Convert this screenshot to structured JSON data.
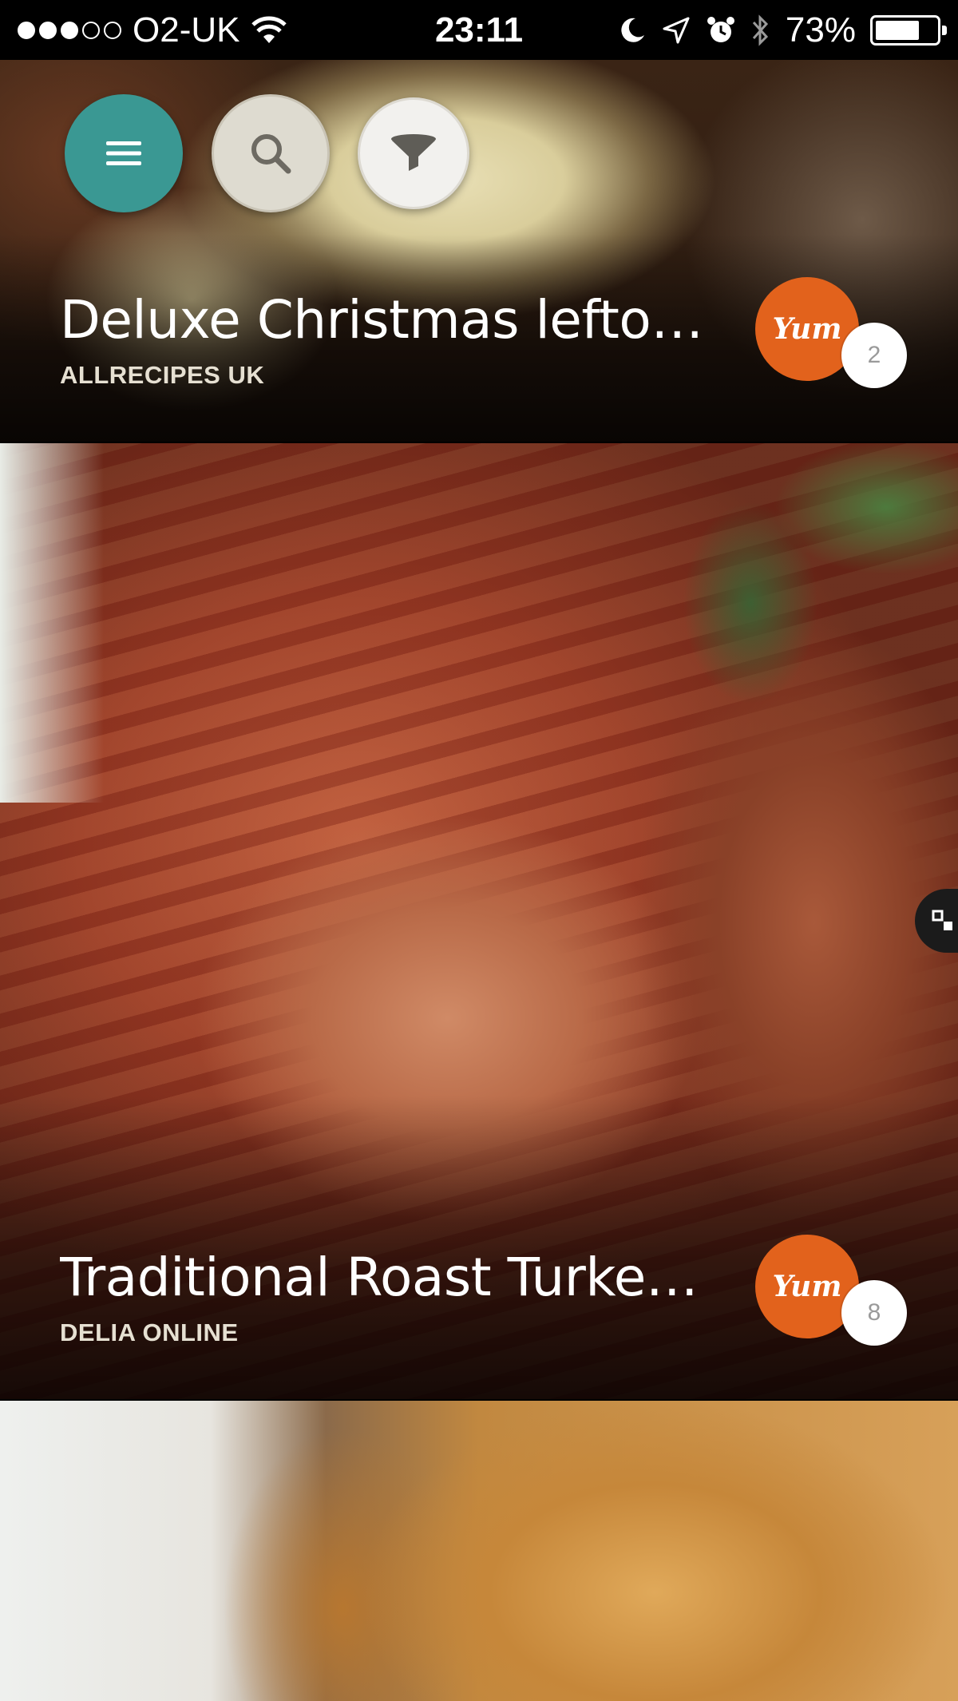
{
  "status_bar": {
    "carrier": "O2-UK",
    "time": "23:11",
    "battery_percent": "73%",
    "battery_level": 0.73,
    "signal_bars_filled": 3,
    "signal_bars_total": 5,
    "icons": [
      "wifi-icon",
      "moon-icon",
      "location-arrow-icon",
      "alarm-icon",
      "bluetooth-icon",
      "battery-icon"
    ]
  },
  "toolbar": {
    "menu_icon": "hamburger-menu-icon",
    "search_icon": "search-icon",
    "filter_icon": "filter-funnel-icon",
    "colors": {
      "menu": "#3a9893",
      "search": "#dedbd0",
      "filter": "#f2f1ee"
    }
  },
  "recipes": [
    {
      "title": "Deluxe Christmas lefto…",
      "source": "ALLRECIPES UK",
      "yum_label": "Yum",
      "yum_count": "2"
    },
    {
      "title": "Traditional Roast Turke…",
      "source": "DELIA ONLINE",
      "yum_label": "Yum",
      "yum_count": "8"
    },
    {
      "title": "",
      "source": ""
    }
  ],
  "colors": {
    "yum_orange": "#e2621c",
    "teal": "#3a9893"
  }
}
